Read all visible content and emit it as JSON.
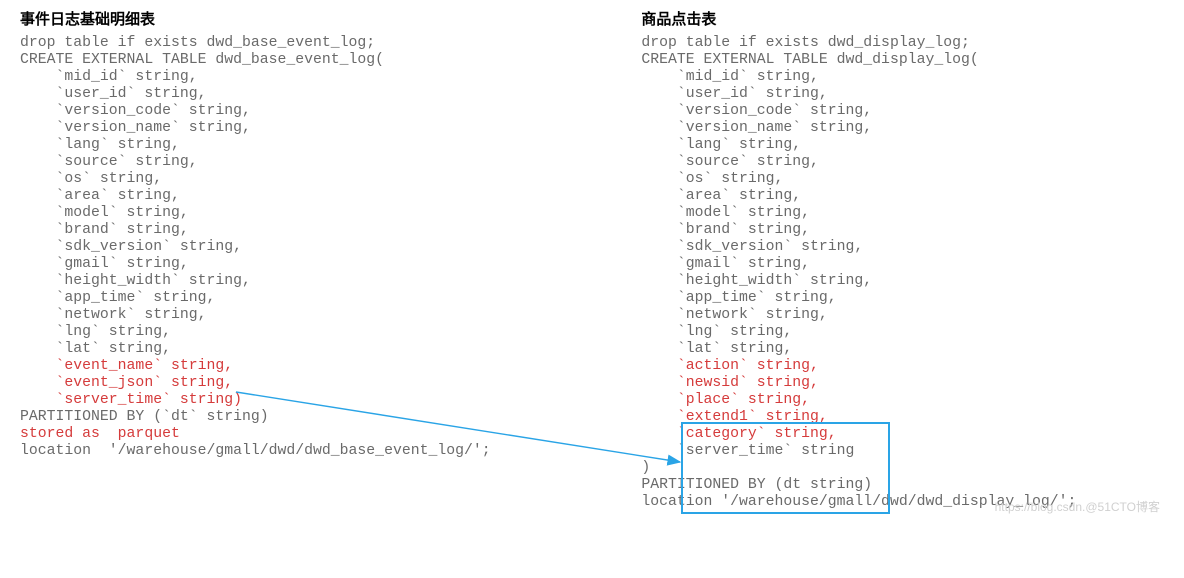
{
  "left": {
    "title": "事件日志基础明细表",
    "l1": "drop table if exists dwd_base_event_log;",
    "l2": "CREATE EXTERNAL TABLE dwd_base_event_log(",
    "l3": "    `mid_id` string,",
    "l4": "    `user_id` string,",
    "l5": "    `version_code` string,",
    "l6": "    `version_name` string,",
    "l7": "    `lang` string,",
    "l8": "    `source` string,",
    "l9": "    `os` string,",
    "l10": "    `area` string,",
    "l11": "    `model` string,",
    "l12": "    `brand` string,",
    "l13": "    `sdk_version` string,",
    "l14": "    `gmail` string,",
    "l15": "    `height_width` string,",
    "l16": "    `app_time` string,",
    "l17": "    `network` string,",
    "l18": "    `lng` string,",
    "l19": "    `lat` string,",
    "l20": "    `event_name` string,",
    "l21": "    `event_json` string,",
    "l22": "    `server_time` string)",
    "l23": "PARTITIONED BY (`dt` string)",
    "l24": "stored as  parquet",
    "l25": "location  '/warehouse/gmall/dwd/dwd_base_event_log/';"
  },
  "right": {
    "title": "商品点击表",
    "l1": "drop table if exists dwd_display_log;",
    "l2": "CREATE EXTERNAL TABLE dwd_display_log(",
    "l3": "    `mid_id` string,",
    "l4": "    `user_id` string,",
    "l5": "    `version_code` string,",
    "l6": "    `version_name` string,",
    "l7": "    `lang` string,",
    "l8": "    `source` string,",
    "l9": "    `os` string,",
    "l10": "    `area` string,",
    "l11": "    `model` string,",
    "l12": "    `brand` string,",
    "l13": "    `sdk_version` string,",
    "l14": "    `gmail` string,",
    "l15": "    `height_width` string,",
    "l16": "    `app_time` string,",
    "l17": "    `network` string,",
    "l18": "    `lng` string,",
    "l19": "    `lat` string,",
    "l20": "    `action` string,",
    "l21": "    `newsid` string,",
    "l22": "    `place` string,",
    "l23": "    `extend1` string,",
    "l24": "    `category` string,",
    "l25": "    `server_time` string",
    "l26": ")",
    "l27": "PARTITIONED BY (dt string)",
    "l28": "location '/warehouse/gmall/dwd/dwd_display_log/';"
  },
  "watermark": "https://blog.csdn.@51CTO博客"
}
